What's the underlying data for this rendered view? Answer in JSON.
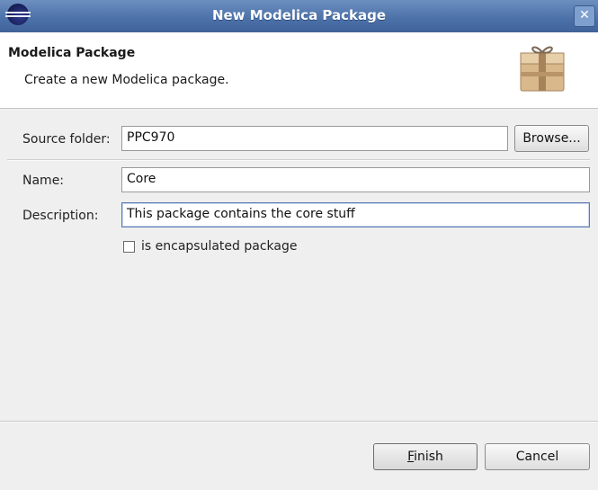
{
  "window": {
    "title": "New Modelica Package",
    "close_glyph": "✕"
  },
  "banner": {
    "title": "Modelica Package",
    "description": "Create a new Modelica package.",
    "icon": "package-icon"
  },
  "form": {
    "source_folder_label": "Source folder:",
    "source_folder_value": "PPC970",
    "browse_label": "Browse...",
    "name_label": "Name:",
    "name_value": "Core",
    "description_label": "Description:",
    "description_value": "This package contains the core stuff",
    "encapsulated_label": "is encapsulated package",
    "encapsulated_checked": false
  },
  "buttons": {
    "finish_mnemonic": "F",
    "finish_rest": "inish",
    "cancel_label": "Cancel"
  },
  "colors": {
    "titlebar": "#4d73aa",
    "dialog_bg": "#efefef",
    "banner_bg": "#ffffff"
  }
}
